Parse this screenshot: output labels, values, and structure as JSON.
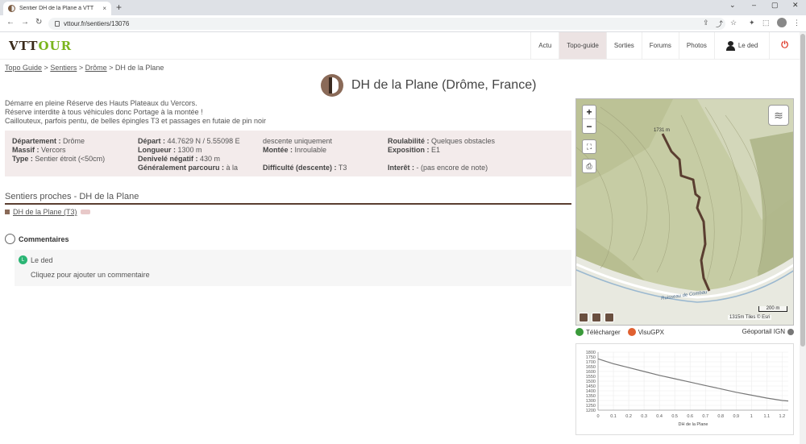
{
  "browser": {
    "tab_title": "Sentier DH de la Plane à VTT",
    "tab_close": "×",
    "new_tab": "+",
    "win_min": "⌄",
    "win_minimize": "–",
    "win_restore": "▢",
    "win_close": "✕",
    "back": "←",
    "forward": "→",
    "reload": "↻",
    "url": "vttour.fr/sentiers/13076",
    "ext_icons": [
      "⇪",
      "⤴",
      "☆",
      "✦",
      "⬚",
      "⋮"
    ]
  },
  "site": {
    "logo_a": "VTT",
    "logo_b": "OUR",
    "nav": [
      {
        "label": "Actu"
      },
      {
        "label": "Topo-guide"
      },
      {
        "label": "Sorties"
      },
      {
        "label": "Forums"
      },
      {
        "label": "Photos"
      },
      {
        "label": "Le ded"
      }
    ],
    "power": "⏻"
  },
  "breadcrumb": {
    "items": [
      "Topo Guide",
      "Sentiers",
      "Drôme"
    ],
    "current": "DH de la Plane",
    "sep": " > "
  },
  "page_title": "DH de la Plane (Drôme, France)",
  "description": [
    "Démarre en pleine Réserve des Hauts Plateaux du Vercors.",
    "Réserve interdite à tous véhicules donc Portage à la montée !",
    "Caillouteux, parfois pentu, de belles épingles T3 et passages en futaie de pin noir"
  ],
  "info": {
    "col1": [
      {
        "k": "Département :",
        "v": " Drôme"
      },
      {
        "k": "Massif :",
        "v": " Vercors"
      },
      {
        "k": "Type :",
        "v": " Sentier étroit (<50cm)"
      }
    ],
    "col2": [
      {
        "k": "Départ :",
        "v": " 44.7629 N / 5.55098 E"
      },
      {
        "k": "Longueur :",
        "v": " 1300 m"
      },
      {
        "k": "Denivelé négatif :",
        "v": " 430 m"
      },
      {
        "k": "Généralement parcouru :",
        "v": " à la"
      }
    ],
    "col3": [
      {
        "k": "",
        "v": "descente uniquement"
      },
      {
        "k": "Montée :",
        "v": " Inroulable"
      },
      {
        "k": "",
        "v": ""
      },
      {
        "k": "Difficulté (descente) :",
        "v": " T3"
      }
    ],
    "col4": [
      {
        "k": "Roulabilité :",
        "v": " Quelques obstacles"
      },
      {
        "k": "Exposition :",
        "v": " E1"
      },
      {
        "k": "",
        "v": ""
      },
      {
        "k": "Interêt :",
        "v": " - (pas encore de note)"
      }
    ]
  },
  "nearby": {
    "title": "Sentiers proches - DH de la Plane",
    "items": [
      {
        "label": "DH de la Plane (T3)"
      }
    ]
  },
  "comments": {
    "title": "Commentaires",
    "user_initial": "L",
    "user": "Le ded",
    "add": "Cliquez pour ajouter un commentaire"
  },
  "map": {
    "zoom_in": "+",
    "zoom_out": "−",
    "fullscreen": "⛶",
    "print": "⎙",
    "layers": "≋",
    "label_top": "1731 m",
    "label_bottom": "1315m",
    "river": "Ruisseau de Combau",
    "scale": "200 m",
    "attribution": "Tiles © Esri",
    "colors": {
      "track": "#5a3e30",
      "terrain": "#c8cea8"
    }
  },
  "map_links": {
    "download": "Télécharger",
    "visugpx": "VisuGPX",
    "geoportail": "Géoportail IGN"
  },
  "chart_data": {
    "type": "line",
    "xlabel": "DH de la Plane",
    "x": [
      0,
      0.1,
      0.2,
      0.3,
      0.4,
      0.5,
      0.6,
      0.7,
      0.8,
      0.9,
      1.0,
      1.1,
      1.2,
      1.24
    ],
    "values": [
      1731,
      1680,
      1640,
      1600,
      1560,
      1525,
      1490,
      1455,
      1420,
      1385,
      1355,
      1325,
      1300,
      1295
    ],
    "xlim": [
      0,
      1.24
    ],
    "ylim": [
      1200,
      1800
    ],
    "xticks": [
      "0",
      "0.1",
      "0.2",
      "0.3",
      "0.4",
      "0.5",
      "0.6",
      "0.7",
      "0.8",
      "0.9",
      "1",
      "1.1",
      "1.2"
    ],
    "yticks": [
      "1800",
      "1700",
      "1600",
      "1500",
      "1400",
      "1300",
      "1200"
    ],
    "yticks_extra": [
      "1750",
      "1650",
      "1550",
      "1450",
      "1350",
      "1250"
    ],
    "grid": true,
    "color": "#777777"
  }
}
